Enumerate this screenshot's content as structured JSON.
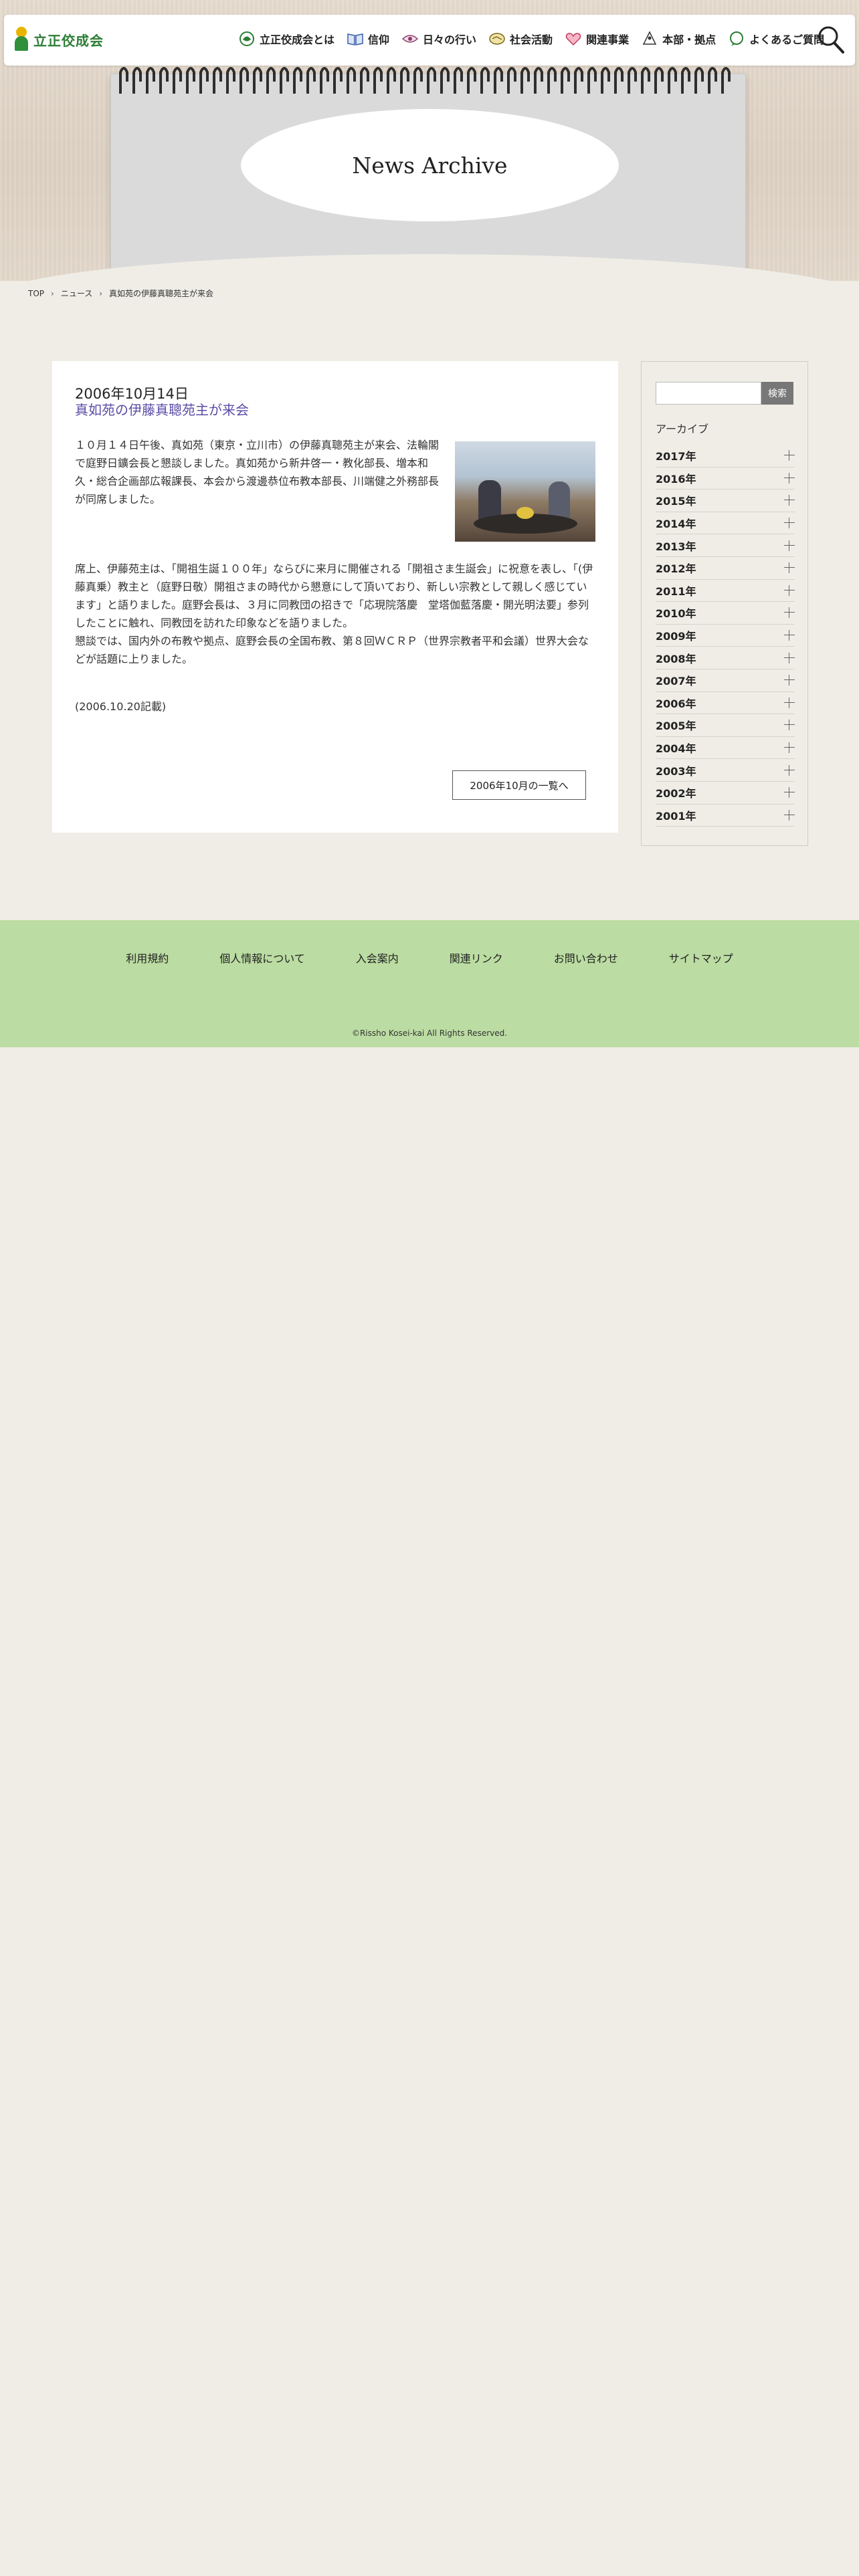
{
  "header": {
    "logo_text": "立正佼成会",
    "nav": [
      {
        "label": "立正佼成会とは",
        "icon": "lotus-icon"
      },
      {
        "label": "信仰",
        "icon": "book-icon"
      },
      {
        "label": "日々の行い",
        "icon": "eye-icon"
      },
      {
        "label": "社会活動",
        "icon": "handshake-icon"
      },
      {
        "label": "関連事業",
        "icon": "heart-icon"
      },
      {
        "label": "本部・拠点",
        "icon": "pin-icon"
      },
      {
        "label": "よくあるご質問",
        "icon": "speech-bubble-icon"
      }
    ],
    "search_icon": "search-icon"
  },
  "hero": {
    "title": "News Archive"
  },
  "breadcrumb": {
    "home": "TOP",
    "section": "ニュース",
    "current": "真如苑の伊藤真聰苑主が来会"
  },
  "article": {
    "date": "2006年10月14日",
    "title": "真如苑の伊藤真聰苑主が来会",
    "paragraph1": "１０月１４日午後、真如苑（東京・立川市）の伊藤真聰苑主が来会、法輪閣で庭野日鑛会長と懇談しました。真如苑から新井啓一・教化部長、増本和久・総合企画部広報課長、本会から渡邊恭位布教本部長、川端健之外務部長が同席しました。",
    "paragraph2_lines": [
      "席上、伊藤苑主は、「開祖生誕１００年」ならびに来月に開催される「開祖さま生誕会」に祝意を表し、「(伊藤真乗）教主と（庭野日敬）開祖さまの時代から懇意にして頂いており、新しい宗教として親しく感じています」と語りました。庭野会長は、３月に同教団の招きで「応現院落慶　堂塔伽藍落慶・開光明法要」参列したことに触れ、同教団を訪れた印象などを語りました。",
      "懇談では、国内外の布教や拠点、庭野会長の全国布教、第８回ＷＣＲＰ（世界宗教者平和会議）世界大会などが話題に上りました。"
    ],
    "note": "(2006.10.20記載)",
    "month_button": "2006年10月の一覧へ"
  },
  "sidebar": {
    "search_button": "検索",
    "archive_label": "アーカイブ",
    "years": [
      "2017年",
      "2016年",
      "2015年",
      "2014年",
      "2013年",
      "2012年",
      "2011年",
      "2010年",
      "2009年",
      "2008年",
      "2007年",
      "2006年",
      "2005年",
      "2004年",
      "2003年",
      "2002年",
      "2001年"
    ]
  },
  "footer": {
    "links": [
      "利用規約",
      "個人情報について",
      "入会案内",
      "関連リンク",
      "お問い合わせ",
      "サイトマップ"
    ],
    "copyright": "©Rissho Kosei-kai All Rights Reserved."
  },
  "colors": {
    "brand_green": "#2b7d34",
    "footer_bg": "#bbdca2",
    "title_purple": "#5b4ca6"
  }
}
